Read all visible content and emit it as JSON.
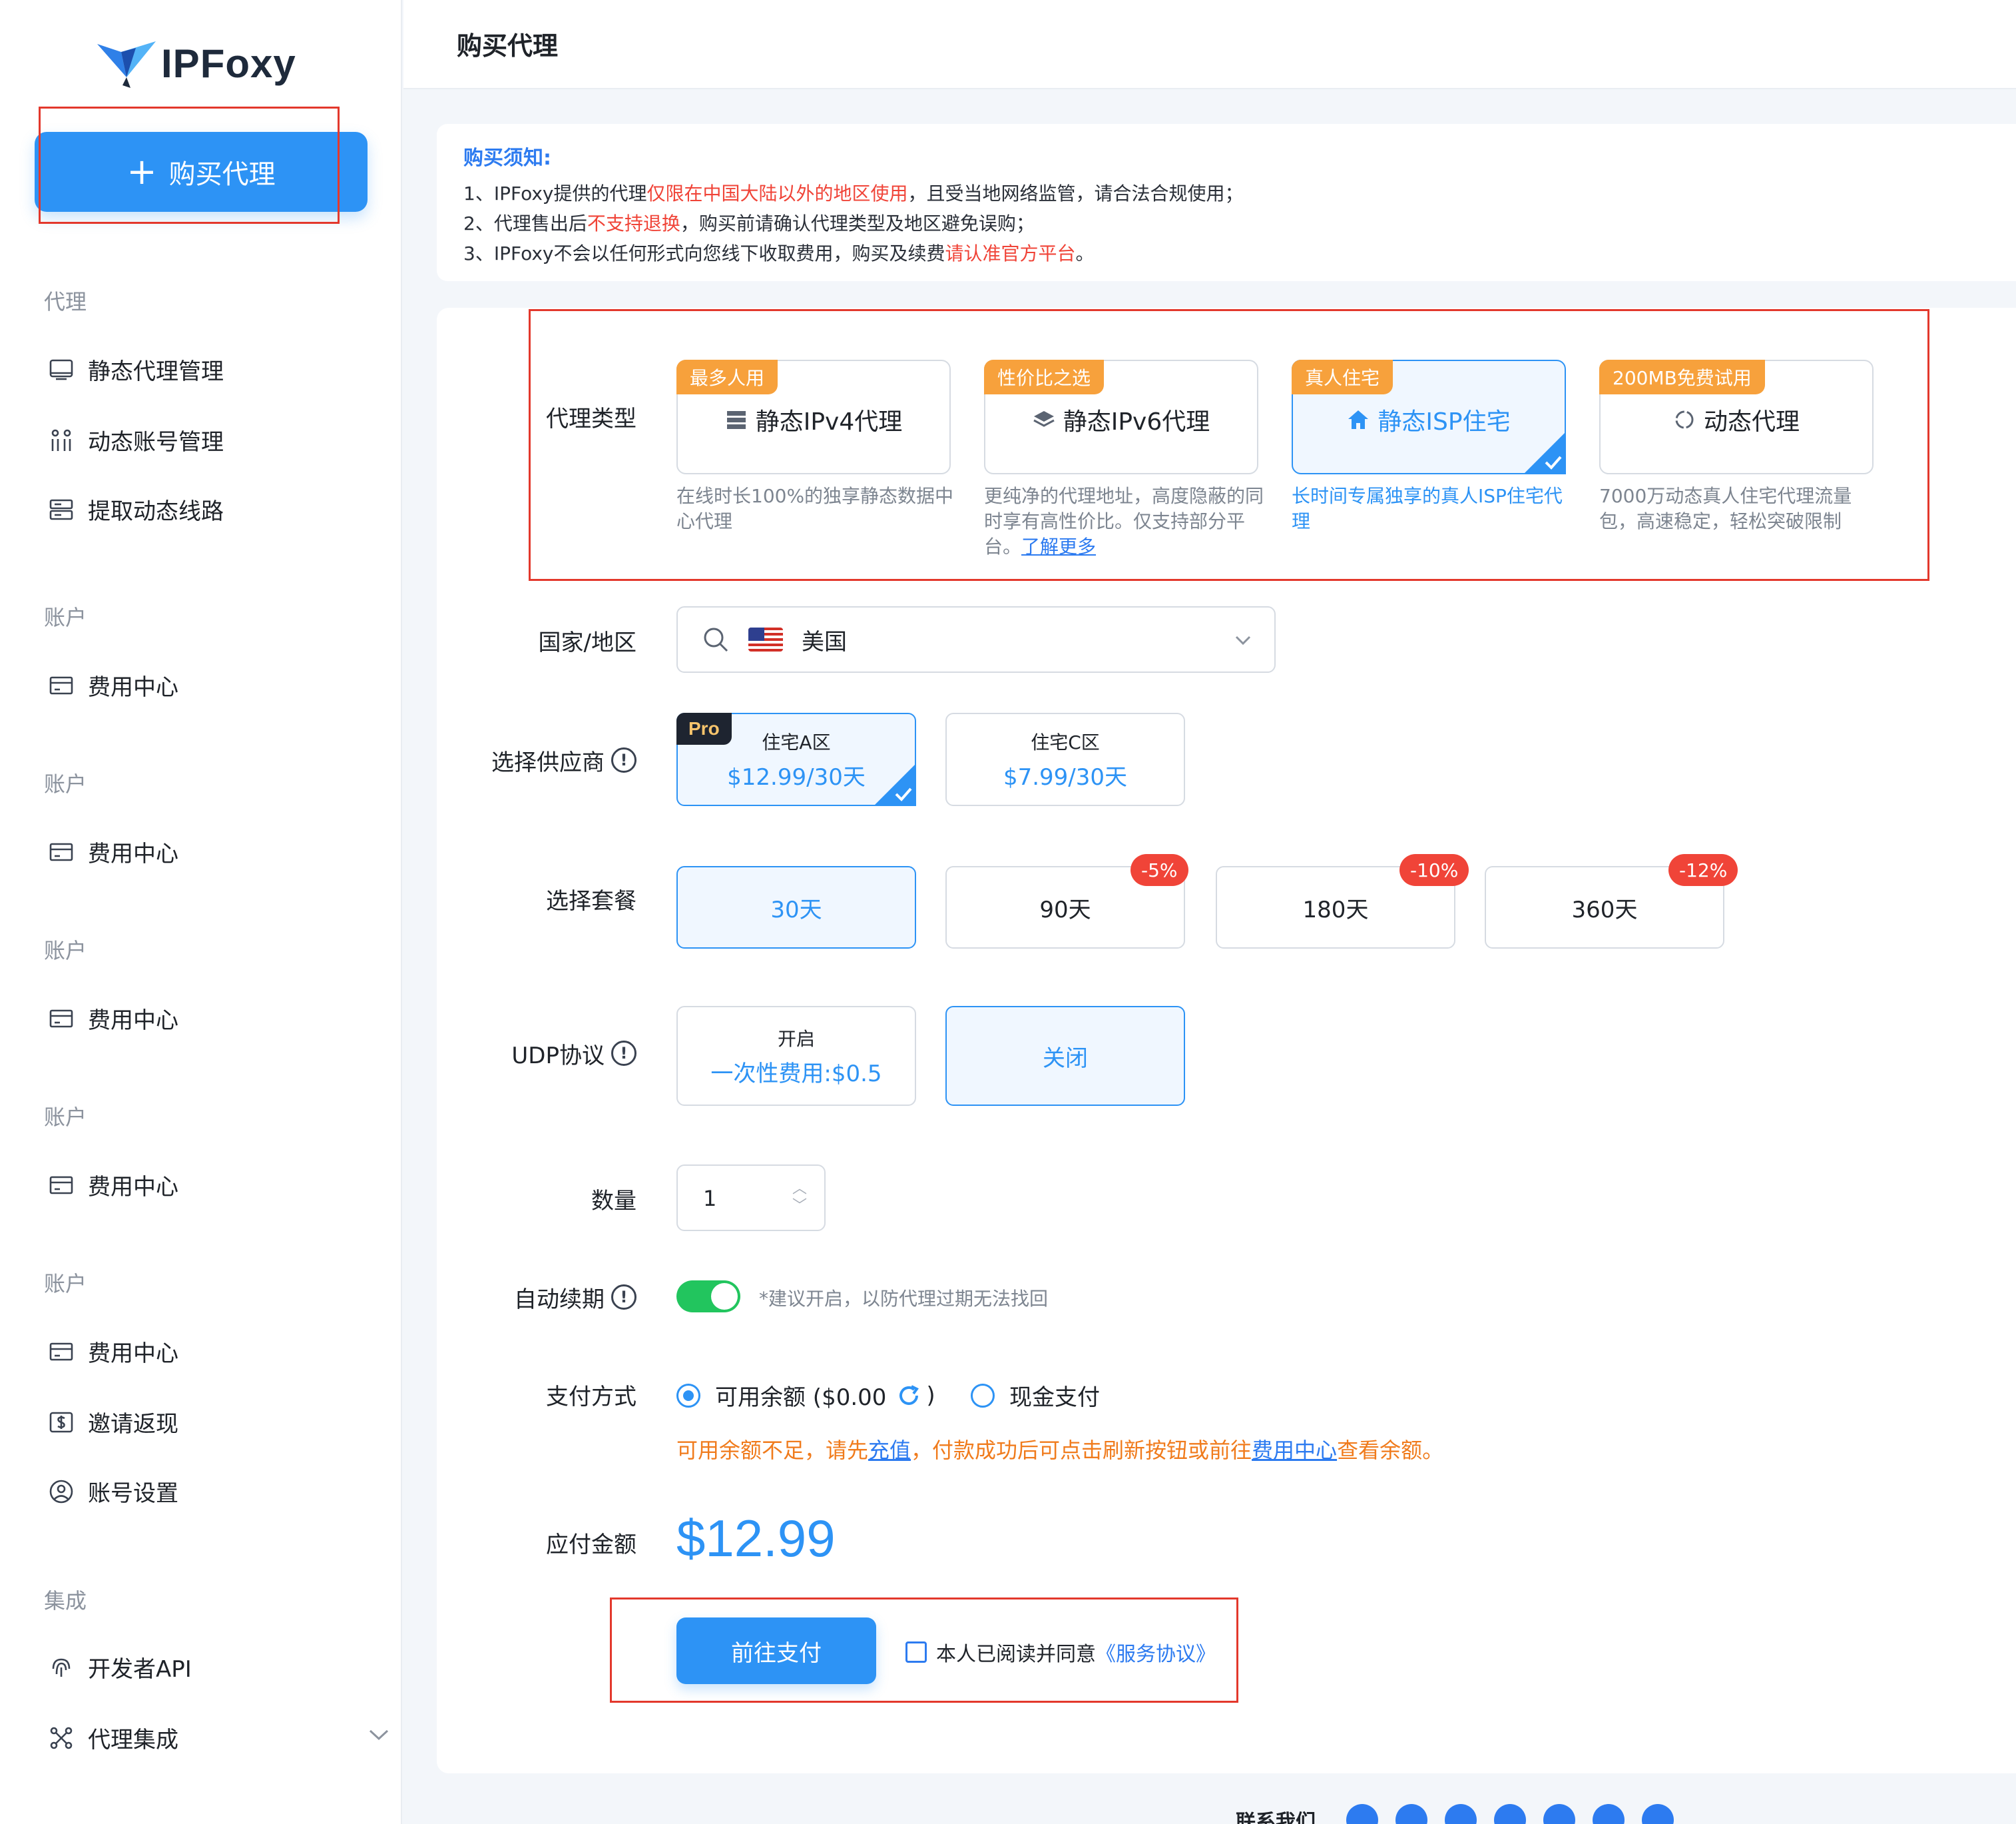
{
  "brand": {
    "name": "IPFoxy"
  },
  "sidebar": {
    "buy_button": "购买代理",
    "sections": [
      {
        "label": "代理"
      },
      {
        "label": "账户"
      },
      {
        "label": "账户"
      },
      {
        "label": "账户"
      },
      {
        "label": "账户"
      },
      {
        "label": "账户"
      },
      {
        "label": "集成"
      }
    ],
    "items": [
      {
        "label": "静态代理管理",
        "icon": "monitor-icon"
      },
      {
        "label": "动态账号管理",
        "icon": "users-icon"
      },
      {
        "label": "提取动态线路",
        "icon": "server-icon"
      },
      {
        "label": "费用中心",
        "icon": "wallet-icon"
      },
      {
        "label": "费用中心",
        "icon": "wallet-icon"
      },
      {
        "label": "费用中心",
        "icon": "wallet-icon"
      },
      {
        "label": "费用中心",
        "icon": "wallet-icon"
      },
      {
        "label": "费用中心",
        "icon": "wallet-icon"
      },
      {
        "label": "邀请返现",
        "icon": "dollar-icon"
      },
      {
        "label": "账号设置",
        "icon": "user-circle-icon"
      },
      {
        "label": "开发者API",
        "icon": "fingerprint-icon"
      },
      {
        "label": "代理集成",
        "icon": "nodes-icon"
      }
    ]
  },
  "header": {
    "title": "购买代理"
  },
  "notice": {
    "title": "购买须知:",
    "line1_a": "1、IPFoxy提供的代理",
    "line1_red": "仅限在中国大陆以外的地区使用",
    "line1_b": "，且受当地网络监管，请合法合规使用；",
    "line2_a": "2、代理售出后",
    "line2_red": "不支持退换",
    "line2_b": "，购买前请确认代理类型及地区避免误购；",
    "line3_a": "3、IPFoxy不会以任何形式向您线下收取费用，购买及续费",
    "line3_red": "请认准官方平台",
    "line3_b": "。"
  },
  "form": {
    "labels": {
      "proxy_type": "代理类型",
      "country": "国家/地区",
      "provider": "选择供应商",
      "package": "选择套餐",
      "udp": "UDP协议",
      "quantity": "数量",
      "auto_renew": "自动续期",
      "payment": "支付方式",
      "total": "应付金额"
    },
    "proxy_types": [
      {
        "badge": "最多人用",
        "name": "静态IPv4代理",
        "desc": "在线时长100%的独享静态数据中心代理",
        "active": false
      },
      {
        "badge": "性价比之选",
        "name": "静态IPv6代理",
        "desc": "更纯净的代理地址，高度隐蔽的同时享有高性价比。仅支持部分平台。",
        "link": "了解更多",
        "active": false
      },
      {
        "badge": "真人住宅",
        "name": "静态ISP住宅",
        "desc": "长时间专属独享的真人ISP住宅代理",
        "active": true
      },
      {
        "badge": "200MB免费试用",
        "name": "动态代理",
        "desc": "7000万动态真人住宅代理流量包，高速稳定，轻松突破限制",
        "active": false
      }
    ],
    "country": {
      "value": "美国"
    },
    "providers": [
      {
        "badge": "Pro",
        "name": "住宅A区",
        "price": "$12.99/30天",
        "active": true
      },
      {
        "name": "住宅C区",
        "price": "$7.99/30天",
        "active": false
      }
    ],
    "packages": [
      {
        "label": "30天",
        "discount": "",
        "active": true
      },
      {
        "label": "90天",
        "discount": "-5%",
        "active": false
      },
      {
        "label": "180天",
        "discount": "-10%",
        "active": false
      },
      {
        "label": "360天",
        "discount": "-12%",
        "active": false
      }
    ],
    "udp": [
      {
        "label": "开启",
        "price": "一次性费用:$0.5",
        "active": false
      },
      {
        "label": "关闭",
        "active": true
      }
    ],
    "quantity": "1",
    "auto_renew_hint": "*建议开启，以防代理过期无法找回",
    "payment": {
      "balance": "可用余额 ($0.00",
      "balance_close": ")",
      "cash": "现金支付",
      "warn_a": "可用余额不足，请先",
      "warn_link1": "充值",
      "warn_b": "，付款成功后可点击刷新按钮或前往",
      "warn_link2": "费用中心",
      "warn_c": "查看余额。"
    },
    "total": "$12.99",
    "pay_button": "前往支付",
    "agree_text": "本人已阅读并同意",
    "agree_link": "《服务协议》"
  },
  "footer": {
    "label": "联系我们"
  },
  "colors": {
    "primary": "#2d93f5",
    "warning": "#f04438",
    "badge": "#f7a13c",
    "success": "#22c55e"
  }
}
